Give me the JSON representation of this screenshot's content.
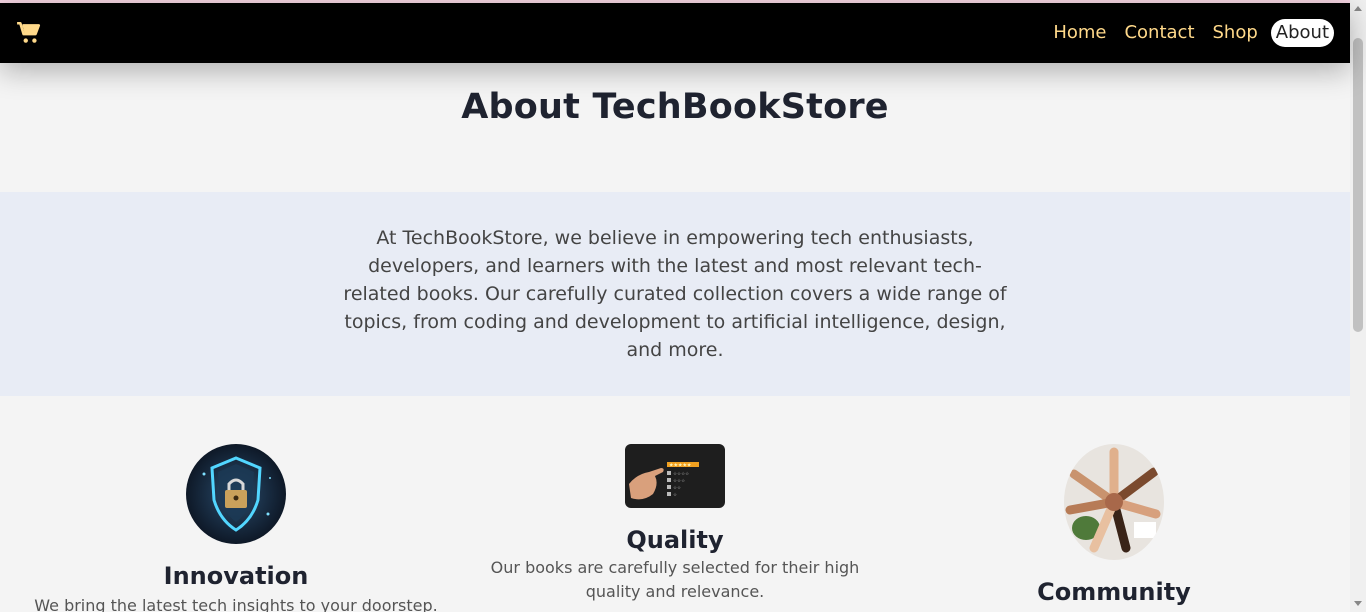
{
  "nav": {
    "cart_icon": "shopping-cart-icon",
    "links": [
      {
        "label": "Home",
        "active": false
      },
      {
        "label": "Contact",
        "active": false
      },
      {
        "label": "Shop",
        "active": false
      },
      {
        "label": "About",
        "active": true
      }
    ]
  },
  "main": {
    "title": "About TechBookStore",
    "intro": "At TechBookStore, we believe in empowering tech enthusiasts, developers, and learners with the latest and most relevant tech-related books. Our carefully curated collection covers a wide range of topics, from coding and development to artificial intelligence, design, and more."
  },
  "features": [
    {
      "title": "Innovation",
      "description": "We bring the latest tech insights to your doorstep.",
      "image": "security-shield-lock-image"
    },
    {
      "title": "Quality",
      "description": "Our books are carefully selected for their high quality and relevance.",
      "image": "star-rating-image"
    },
    {
      "title": "Community",
      "description": "",
      "image": "team-hands-image"
    }
  ],
  "colors": {
    "navbar_bg": "#000000",
    "nav_link": "#ffd98a",
    "intro_band": "#e8ecf5",
    "page_bg": "#f4f4f4"
  }
}
